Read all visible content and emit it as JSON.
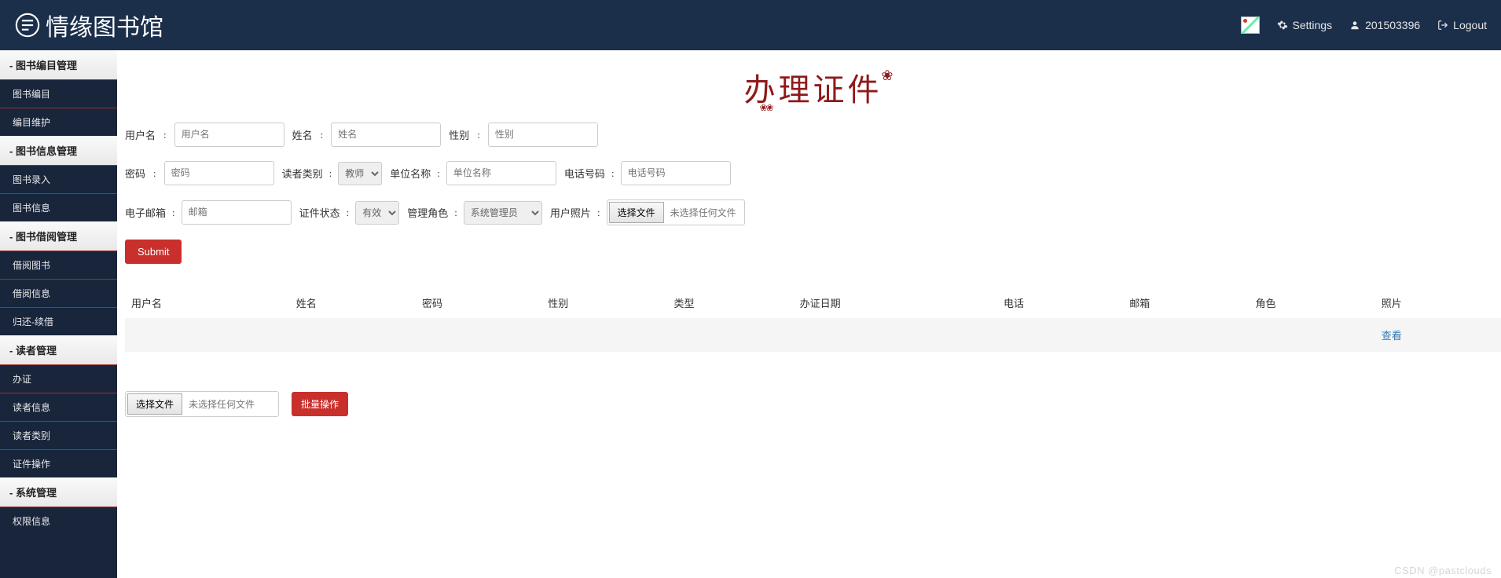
{
  "header": {
    "logo_text": "情缘图书馆",
    "settings_label": "Settings",
    "user_id": "201503396",
    "logout_label": "Logout"
  },
  "sidebar": {
    "groups": [
      {
        "title": "图书编目管理",
        "items": [
          "图书编目",
          "编目维护"
        ]
      },
      {
        "title": "图书信息管理",
        "items": [
          "图书录入",
          "图书信息"
        ]
      },
      {
        "title": "图书借阅管理",
        "items": [
          "借阅图书",
          "借阅信息",
          "归还-续借"
        ]
      },
      {
        "title": "读者管理",
        "items": [
          "办证",
          "读者信息",
          "读者类别",
          "证件操作"
        ]
      },
      {
        "title": "系统管理",
        "items": [
          "权限信息"
        ]
      }
    ]
  },
  "page": {
    "title": "办理证件",
    "submit_label": "Submit",
    "batch_label": "批量操作",
    "file_button": "选择文件",
    "file_none": "未选择任何文件"
  },
  "form": {
    "username": {
      "label": "用户名",
      "placeholder": "用户名"
    },
    "name": {
      "label": "姓名",
      "placeholder": "姓名"
    },
    "gender": {
      "label": "性别",
      "placeholder": "性别"
    },
    "password": {
      "label": "密码",
      "placeholder": "密码"
    },
    "reader_type": {
      "label": "读者类别",
      "selected": "教师"
    },
    "org": {
      "label": "单位名称",
      "placeholder": "单位名称"
    },
    "phone": {
      "label": "电话号码",
      "placeholder": "电话号码"
    },
    "email": {
      "label": "电子邮箱",
      "placeholder": "邮箱"
    },
    "cert_status": {
      "label": "证件状态",
      "selected": "有效"
    },
    "role": {
      "label": "管理角色",
      "selected": "系统管理员"
    },
    "photo": {
      "label": "用户照片"
    }
  },
  "table": {
    "headers": [
      "用户名",
      "姓名",
      "密码",
      "性别",
      "类型",
      "办证日期",
      "电话",
      "邮箱",
      "角色",
      "照片"
    ],
    "view_label": "查看"
  },
  "watermark": "CSDN @pastclouds"
}
